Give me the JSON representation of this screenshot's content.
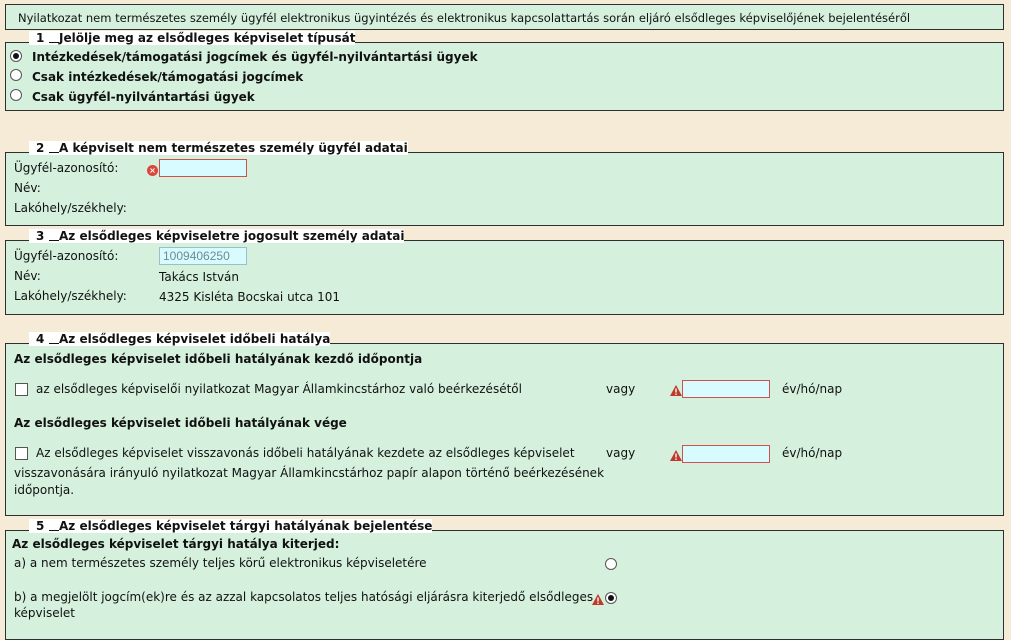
{
  "header": {
    "title": "Nyilatkozat nem természetes személy ügyfél elektronikus ügyintézés és elektronikus kapcsolattartás során eljáró elsődleges képviselőjének bejelentéséről"
  },
  "s1": {
    "num": "1",
    "title": "Jelölje meg az elsődleges képviselet típusát",
    "options": [
      {
        "label": "Intézkedések/támogatási jogcímek és ügyfél-nyilvántartási ügyek",
        "selected": true
      },
      {
        "label": "Csak intézkedések/támogatási jogcímek",
        "selected": false
      },
      {
        "label": "Csak ügyfél-nyilvántartási ügyek",
        "selected": false
      }
    ]
  },
  "s2": {
    "num": "2",
    "title": "A képviselt nem természetes személy ügyfél adatai",
    "id_label": "Ügyfél-azonosító:",
    "id_value": "",
    "name_label": "Név:",
    "name_value": "",
    "addr_label": "Lakóhely/székhely:",
    "addr_value": ""
  },
  "s3": {
    "num": "3",
    "title": "Az elsődleges képviseletre jogosult személy adatai",
    "id_label": "Ügyfél-azonosító:",
    "id_value": "1009406250",
    "name_label": "Név:",
    "name_value": "Takács István",
    "addr_label": "Lakóhely/székhely:",
    "addr_value": "4325 Kisléta Bocskai utca 101"
  },
  "s4": {
    "num": "4",
    "title": "Az elsődleges képviselet időbeli hatálya",
    "start_heading": "Az elsődleges képviselet időbeli hatályának kezdő időpontja",
    "start_check_label": "az elsődleges képviselői nyilatkozat Magyar Államkincstárhoz való beérkezésétől",
    "or_label": "vagy",
    "date_unit": "év/hó/nap",
    "start_date": "",
    "end_heading": "Az elsődleges képviselet időbeli hatályának vége",
    "end_check_line1": "Az elsődleges képviselet visszavonás időbeli hatályának kezdete az elsődleges képviselet",
    "end_check_line2": "visszavonására irányuló nyilatkozat Magyar Államkincstárhoz papír alapon történő beérkezésének",
    "end_check_line3": "időpontja.",
    "end_date": ""
  },
  "s5": {
    "num": "5",
    "title": "Az elsődleges képviselet tárgyi hatályának bejelentése",
    "heading": "Az elsődleges képviselet tárgyi hatálya kiterjed:",
    "option_a": "a) a nem természetes személy teljes körű elektronikus képviseletére",
    "option_a_selected": false,
    "option_b_line1": "b) a megjelölt jogcím(ek)re és az azzal kapcsolatos teljes hatósági eljárásra kiterjedő elsődleges",
    "option_b_line2": "képviselet",
    "option_b_selected": true
  },
  "colors": {
    "panel": "#d5f0dc",
    "background": "#f5ebd6",
    "input": "#d8fbff",
    "error": "#d9483b"
  }
}
